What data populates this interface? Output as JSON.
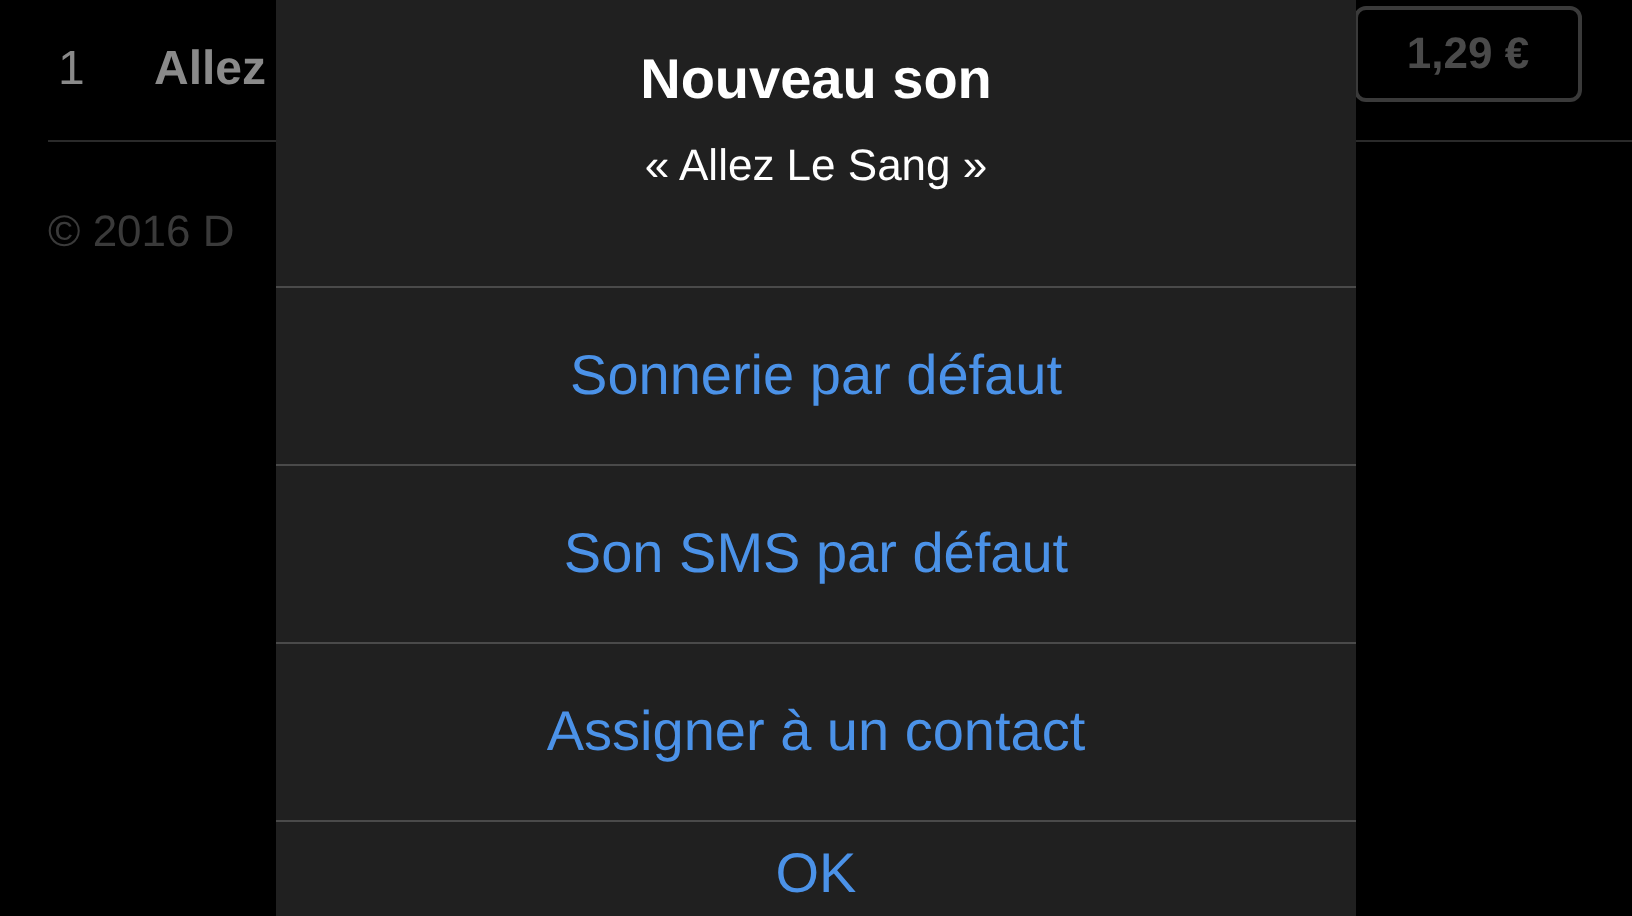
{
  "track_row": {
    "number": "1",
    "title": "Allez",
    "price": "1,29 €"
  },
  "footer": {
    "copyright": "© 2016 D"
  },
  "alert": {
    "title": "Nouveau son",
    "subtitle": "« Allez Le Sang »",
    "actions": [
      {
        "label": "Sonnerie par défaut"
      },
      {
        "label": "Son SMS par défaut"
      },
      {
        "label": "Assigner à un contact"
      },
      {
        "label": "OK"
      }
    ]
  }
}
